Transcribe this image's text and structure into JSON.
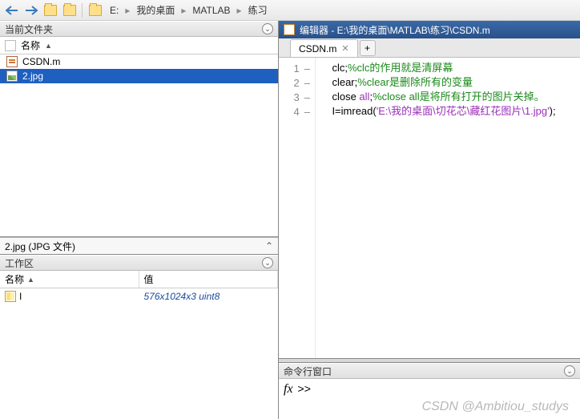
{
  "toolbar": {
    "crumbs": [
      "E:",
      "我的桌面",
      "MATLAB",
      "练习"
    ]
  },
  "filePanel": {
    "title": "当前文件夹",
    "colName": "名称",
    "files": [
      {
        "name": "CSDN.m",
        "type": "m"
      },
      {
        "name": "2.jpg",
        "type": "jpg"
      }
    ],
    "detailsLine": "2.jpg  (JPG 文件)"
  },
  "workspace": {
    "title": "工作区",
    "colName": "名称",
    "colValue": "值",
    "rows": [
      {
        "name": "I",
        "value": "576x1024x3 uint8"
      }
    ]
  },
  "editor": {
    "title": "编辑器 - E:\\我的桌面\\MATLAB\\练习\\CSDN.m",
    "tab": "CSDN.m",
    "lines": [
      {
        "n": 1,
        "tokens": [
          {
            "t": "clc",
            "c": "plain"
          },
          {
            "t": ";",
            "c": "plain"
          },
          {
            "t": "%clc的作用就是清屏幕",
            "c": "cm"
          }
        ]
      },
      {
        "n": 2,
        "tokens": [
          {
            "t": "clear",
            "c": "plain"
          },
          {
            "t": ";",
            "c": "plain"
          },
          {
            "t": "%clear是删除所有的变量",
            "c": "cm"
          }
        ]
      },
      {
        "n": 3,
        "tokens": [
          {
            "t": "close ",
            "c": "plain"
          },
          {
            "t": "all",
            "c": "str"
          },
          {
            "t": ";",
            "c": "plain"
          },
          {
            "t": "%close all是将所有打开的图片关掉。",
            "c": "cm"
          }
        ]
      },
      {
        "n": 4,
        "tokens": [
          {
            "t": "I=imread(",
            "c": "plain"
          },
          {
            "t": "'E:\\我的桌面\\切花芯\\藏红花图片\\1.jpg'",
            "c": "str"
          },
          {
            "t": ");",
            "c": "plain"
          }
        ]
      }
    ]
  },
  "cmd": {
    "title": "命令行窗口",
    "prompt": ">>"
  },
  "watermark": "CSDN @Ambitiou_studys"
}
